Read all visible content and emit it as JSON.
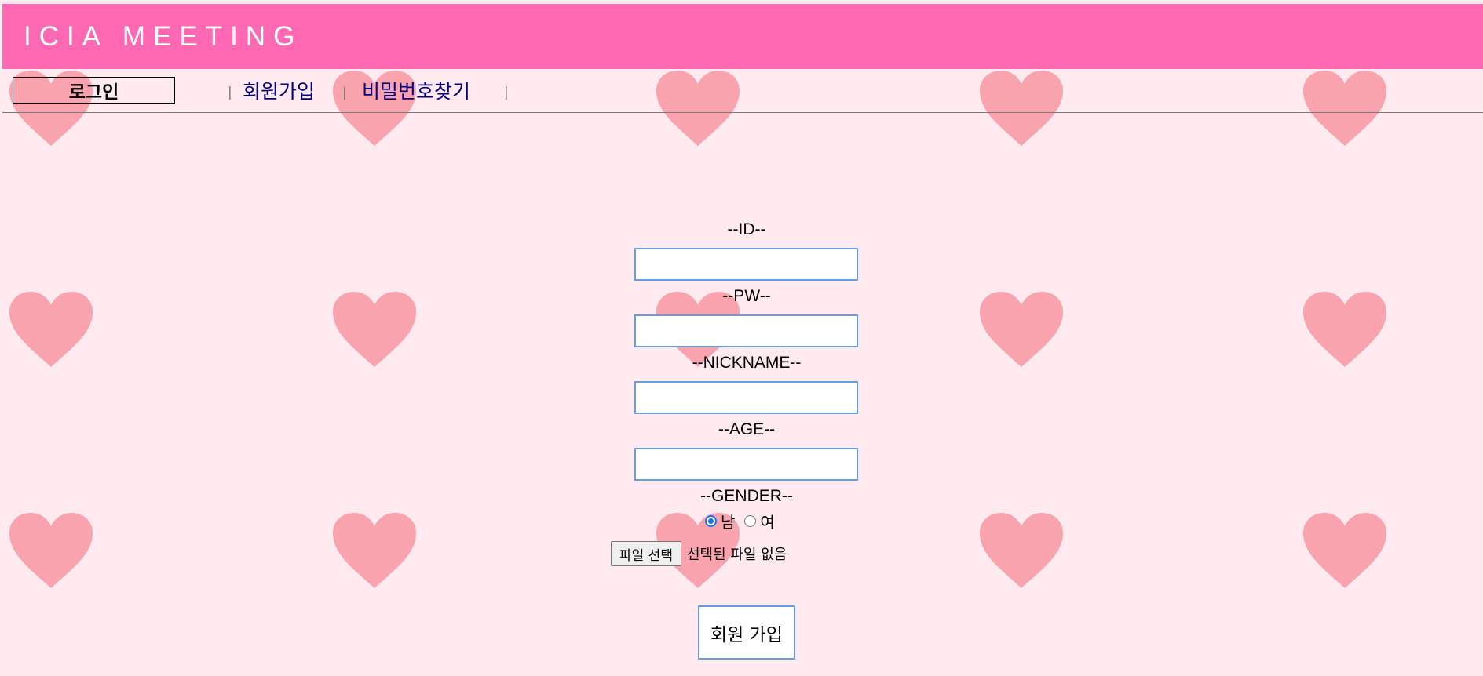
{
  "header": {
    "title": "ICIA MEETING"
  },
  "nav": {
    "login_label": "로그인",
    "separator": "|",
    "links": [
      "회원가입",
      "비밀번호찾기"
    ]
  },
  "form": {
    "id_label": "--ID--",
    "id_value": "",
    "pw_label": "--PW--",
    "pw_value": "",
    "nickname_label": "--NICKNAME--",
    "nickname_value": "",
    "age_label": "--AGE--",
    "age_value": "",
    "gender_label": "--GENDER--",
    "gender_options": [
      {
        "label": "남",
        "checked": true
      },
      {
        "label": "여",
        "checked": false
      }
    ],
    "file_button_label": "파일 선택",
    "file_status": "선택된 파일 없음",
    "submit_label": "회원 가입"
  },
  "colors": {
    "header_bg": "#ff69b4",
    "page_bg": "#ffeaef",
    "heart": "#f9a3ae",
    "link": "#000080",
    "input_border": "#6a9bdc"
  },
  "icons": {
    "background_pattern": "heart-icon"
  }
}
